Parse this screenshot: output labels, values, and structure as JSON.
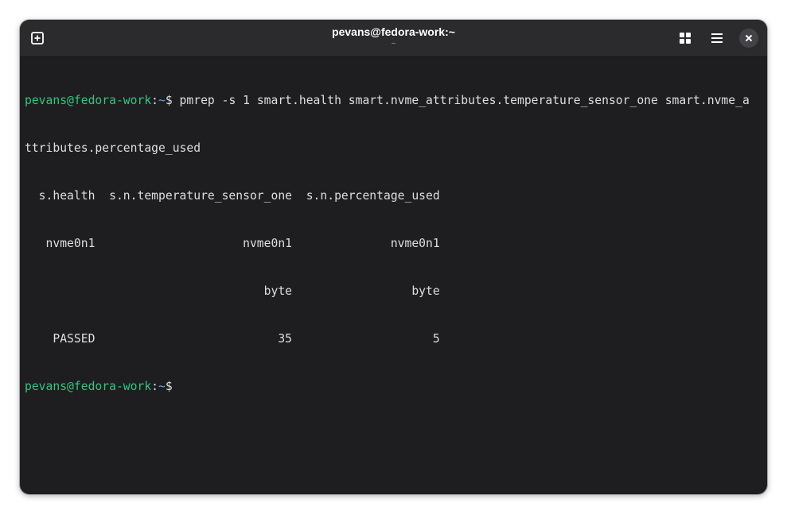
{
  "window": {
    "title": "pevans@fedora-work:~",
    "subtitle": "~"
  },
  "icons": {
    "new_tab": "new-tab-icon",
    "view": "grid-view-icon",
    "menu": "hamburger-menu-icon",
    "close": "close-icon"
  },
  "colors": {
    "background": "#1e1e20",
    "titlebar": "#2b2b2e",
    "prompt_user": "#33c481",
    "prompt_path": "#6aa6e8",
    "text": "#dedede"
  },
  "terminal": {
    "prompt1": {
      "user_host": "pevans@fedora-work",
      "sep": ":",
      "path": "~",
      "symbol": "$ ",
      "command": "pmrep -s 1 smart.health smart.nvme_attributes.temperature_sensor_one smart.nvme_a"
    },
    "wrap_line": "ttributes.percentage_used",
    "output": [
      "  s.health  s.n.temperature_sensor_one  s.n.percentage_used",
      "   nvme0n1                     nvme0n1              nvme0n1",
      "                                  byte                 byte",
      "    PASSED                          35                    5"
    ],
    "prompt2": {
      "user_host": "pevans@fedora-work",
      "sep": ":",
      "path": "~",
      "symbol": "$"
    }
  }
}
